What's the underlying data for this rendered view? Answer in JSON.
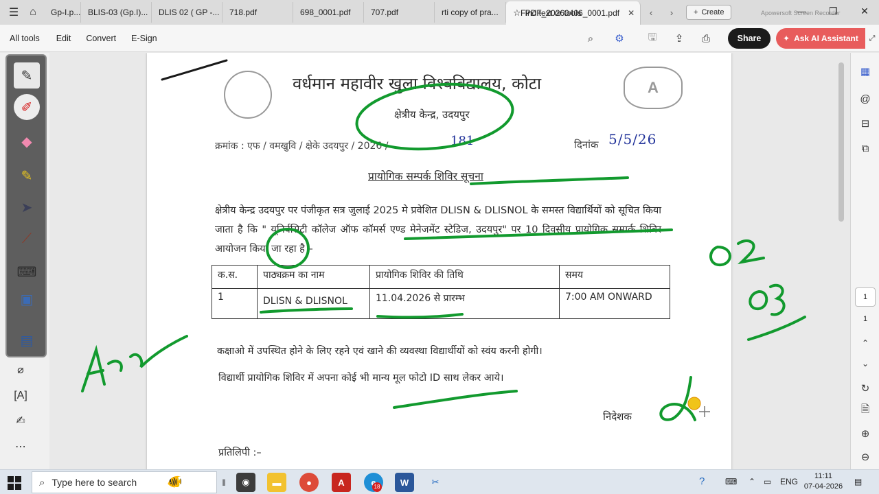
{
  "tabs": [
    {
      "label": "Gp-I.p..."
    },
    {
      "label": "BLIS-03 (Gp.I)..."
    },
    {
      "label": "DLIS 02 ( GP -..."
    },
    {
      "label": "718.pdf"
    },
    {
      "label": "698_0001.pdf"
    },
    {
      "label": "707.pdf"
    },
    {
      "label": "rti copy of pra..."
    },
    {
      "label": "PDF_20260406_0001.pdf"
    }
  ],
  "create_label": "Create",
  "menu": [
    "All tools",
    "Edit",
    "Convert",
    "E-Sign"
  ],
  "find_label": "Find text or tools",
  "share_label": "Share",
  "ai_label": "Ask AI Assistant",
  "doc": {
    "title": "वर्धमान महावीर खुला विश्वविद्यालय, कोटा",
    "subtitle": "क्षेत्रीय केन्द्र, उदयपुर",
    "ref_text": "क्रमांक : एफ / वमखुवि / क्षेके उदयपुर / 2026 /",
    "ref_handwritten": "181",
    "date_label": "दिनांक",
    "date_handwritten": "5/5/26",
    "notice_title": "प्रायोगिक सम्पर्क शिविर सूचना",
    "paragraph": "क्षेत्रीय केन्द्र उदयपुर पर पंजीकृत सत्र जुलाई 2025 मे प्रवेशित DLISN & DLISNOL के समस्त विद्यार्थियों को सूचित किया जाता है कि \" यूनिर्वसिटी कॉलेज ऑफ कॉमर्स एण्ड मेनेजमेंट स्टेडिज, उदयपुर\" पर 10 दिवसीय प्रायोगिक सम्पर्क शिविर आयोजन किया जा रहा है –",
    "table": {
      "headers": [
        "क.स.",
        "पाठ्यक्रम का नाम",
        "प्रायोगिक शिविर की तिथि",
        "समय"
      ],
      "rows": [
        [
          "1",
          "DLISN & DLISNOL",
          "11.04.2026 से प्रारम्भ",
          "7:00  AM ONWARD"
        ]
      ]
    },
    "line1": "कक्षाओ में उपस्थित होने के लिए रहने एवं खाने की व्यवस्था विद्यार्थीयों को स्वंय करनी होगी।",
    "line2": "विद्यार्थी प्रायोगिक शिविर में अपना कोई भी मान्य मूल फोटो ID साथ लेकर आये।",
    "signatory": "निदेशक",
    "copy_label": "प्रतिलिपी :–"
  },
  "annotations": {
    "left_word": "Arch",
    "right_numbers": [
      "02",
      "03"
    ],
    "ink_color": "#129a2e"
  },
  "page_nav": {
    "current": "1",
    "total": "1"
  },
  "taskbar": {
    "search_placeholder": "Type here to search",
    "lang": "ENG",
    "time": "11:11",
    "date": "07-04-2026",
    "badge_count": "18"
  },
  "watermark": "Apowersoft Screen Recorder",
  "colors": {
    "accent_red": "#e85c5c",
    "share_bg": "#1b1b1b",
    "pdf_red": "#c8261f"
  }
}
